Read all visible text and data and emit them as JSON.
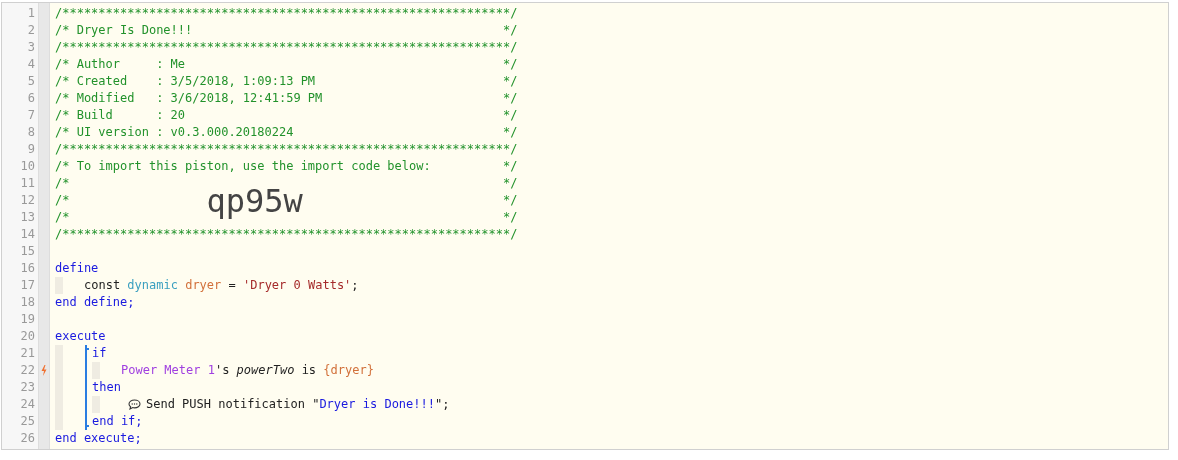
{
  "editor": {
    "lines": [
      {
        "number": "1",
        "task": false,
        "trigger": false,
        "tokens": [
          {
            "kind": "comment",
            "text": "/**************************************************************/"
          }
        ]
      },
      {
        "number": "2",
        "task": false,
        "trigger": false,
        "tokens": [
          {
            "kind": "comment",
            "text": "/* Dryer Is Done!!!"
          },
          {
            "kind": "comment_end",
            "text": "*/"
          }
        ]
      },
      {
        "number": "3",
        "task": false,
        "trigger": false,
        "tokens": [
          {
            "kind": "comment",
            "text": "/**************************************************************/"
          }
        ]
      },
      {
        "number": "4",
        "task": false,
        "trigger": false,
        "tokens": [
          {
            "kind": "comment",
            "text": "/* Author     : Me"
          },
          {
            "kind": "comment_end",
            "text": "*/"
          }
        ]
      },
      {
        "number": "5",
        "task": false,
        "trigger": false,
        "tokens": [
          {
            "kind": "comment",
            "text": "/* Created    : 3/5/2018, 1:09:13 PM"
          },
          {
            "kind": "comment_end",
            "text": "*/"
          }
        ]
      },
      {
        "number": "6",
        "task": false,
        "trigger": false,
        "tokens": [
          {
            "kind": "comment",
            "text": "/* Modified   : 3/6/2018, 12:41:59 PM"
          },
          {
            "kind": "comment_end",
            "text": "*/"
          }
        ]
      },
      {
        "number": "7",
        "task": false,
        "trigger": false,
        "tokens": [
          {
            "kind": "comment",
            "text": "/* Build      : 20"
          },
          {
            "kind": "comment_end",
            "text": "*/"
          }
        ]
      },
      {
        "number": "8",
        "task": false,
        "trigger": false,
        "tokens": [
          {
            "kind": "comment",
            "text": "/* UI version : v0.3.000.20180224"
          },
          {
            "kind": "comment_end",
            "text": "*/"
          }
        ]
      },
      {
        "number": "9",
        "task": false,
        "trigger": false,
        "tokens": [
          {
            "kind": "comment",
            "text": "/**************************************************************/"
          }
        ]
      },
      {
        "number": "10",
        "task": false,
        "trigger": false,
        "tokens": [
          {
            "kind": "comment",
            "text": "/* To import this piston, use the import code below:"
          },
          {
            "kind": "comment_end",
            "text": "*/"
          }
        ]
      },
      {
        "number": "11",
        "task": false,
        "trigger": false,
        "tokens": [
          {
            "kind": "comment",
            "text": "/*"
          },
          {
            "kind": "comment_end",
            "text": "*/"
          }
        ]
      },
      {
        "number": "12",
        "task": false,
        "trigger": false,
        "tokens": [
          {
            "kind": "comment",
            "text": "/*"
          },
          {
            "kind": "import_code",
            "text": "qp95w"
          },
          {
            "kind": "comment_end",
            "text": "*/"
          }
        ]
      },
      {
        "number": "13",
        "task": false,
        "trigger": false,
        "tokens": [
          {
            "kind": "comment",
            "text": "/*"
          },
          {
            "kind": "comment_end",
            "text": "*/"
          }
        ]
      },
      {
        "number": "14",
        "task": false,
        "trigger": false,
        "tokens": [
          {
            "kind": "comment",
            "text": "/**************************************************************/"
          }
        ]
      },
      {
        "number": "15",
        "task": false,
        "trigger": false
      },
      {
        "number": "16",
        "task": false,
        "trigger": false,
        "tokens": [
          {
            "kind": "keyword",
            "text": "define"
          }
        ],
        "bracket": false,
        "children": [
          {
            "number": "17",
            "task": false,
            "trigger": false,
            "tokens": [
              {
                "kind": "plain",
                "text": "const "
              },
              {
                "kind": "type",
                "text": "dynamic "
              },
              {
                "kind": "variable",
                "text": "dryer"
              },
              {
                "kind": "plain",
                "text": " = "
              },
              {
                "kind": "string",
                "text": "'Dryer 0 Watts'"
              },
              {
                "kind": "plain",
                "text": ";"
              }
            ]
          }
        ]
      },
      {
        "number": "18",
        "task": false,
        "trigger": false,
        "tokens": [
          {
            "kind": "keyword",
            "text": "end define;"
          }
        ]
      },
      {
        "number": "19",
        "task": false,
        "trigger": false
      },
      {
        "number": "20",
        "task": false,
        "trigger": false,
        "tokens": [
          {
            "kind": "keyword",
            "text": "execute"
          }
        ],
        "bracket": true,
        "children": [
          {
            "number": "21",
            "task": false,
            "trigger": false,
            "tokens": [
              {
                "kind": "keyword",
                "text": "if"
              }
            ],
            "bracket": false,
            "children": [
              {
                "number": "22",
                "task": false,
                "trigger": true,
                "tokens": [
                  {
                    "kind": "device",
                    "text": "Power Meter 1"
                  },
                  {
                    "kind": "plain",
                    "text": "'s "
                  },
                  {
                    "kind": "attribute",
                    "text": "powerTwo"
                  },
                  {
                    "kind": "plain",
                    "text": " is "
                  },
                  {
                    "kind": "variable",
                    "text": "{dryer}"
                  }
                ]
              }
            ]
          },
          {
            "number": "23",
            "task": false,
            "trigger": false,
            "tokens": [
              {
                "kind": "keyword",
                "text": "then"
              }
            ],
            "bracket": false,
            "children": [
              {
                "number": "24",
                "task": true,
                "trigger": false,
                "tokens": [
                  {
                    "kind": "plain",
                    "text": "Send PUSH notification \""
                  },
                  {
                    "kind": "text_value",
                    "text": "Dryer is Done!!!"
                  },
                  {
                    "kind": "plain",
                    "text": "\";"
                  }
                ]
              }
            ]
          },
          {
            "number": "25",
            "task": false,
            "trigger": false,
            "tokens": [
              {
                "kind": "keyword",
                "text": "end if;"
              }
            ]
          }
        ]
      },
      {
        "number": "26",
        "task": false,
        "trigger": false,
        "tokens": [
          {
            "kind": "keyword",
            "text": "end execute;"
          }
        ]
      }
    ]
  }
}
